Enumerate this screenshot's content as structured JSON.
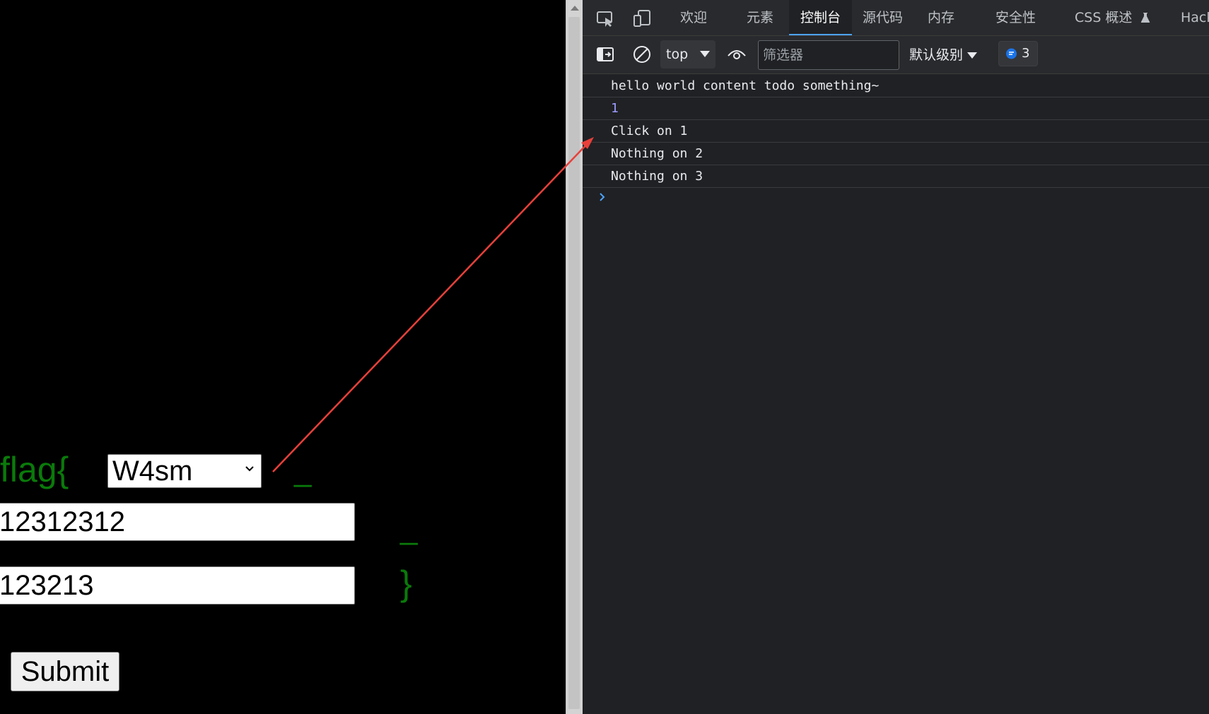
{
  "page": {
    "flag_prefix": "flag{",
    "separator_1": "_",
    "separator_2": "_",
    "flag_suffix": "}",
    "select_value": "W4sm",
    "input_1_value": "12312312",
    "input_2_value": "123213",
    "submit_label": "Submit"
  },
  "devtools": {
    "tabs": [
      {
        "label": "欢迎"
      },
      {
        "label": "元素"
      },
      {
        "label": "控制台"
      },
      {
        "label": "源代码"
      },
      {
        "label": "内存"
      },
      {
        "label": "安全性"
      },
      {
        "label": "CSS 概述"
      },
      {
        "label": "Hack"
      }
    ],
    "active_tab": "控制台",
    "toolbar": {
      "context": "top",
      "filter_placeholder": "筛选器",
      "levels_label": "默认级别",
      "issues_count": "3"
    },
    "console": [
      "hello world content todo something~",
      "1",
      "Click on 1",
      "Nothing on 2",
      "Nothing on 3"
    ]
  },
  "colors": {
    "flag_green": "#0a7a0a",
    "annotation_arrow": "#e8403a",
    "active_tab_indicator": "#4da3ff",
    "issues_icon": "#1a73e8"
  }
}
